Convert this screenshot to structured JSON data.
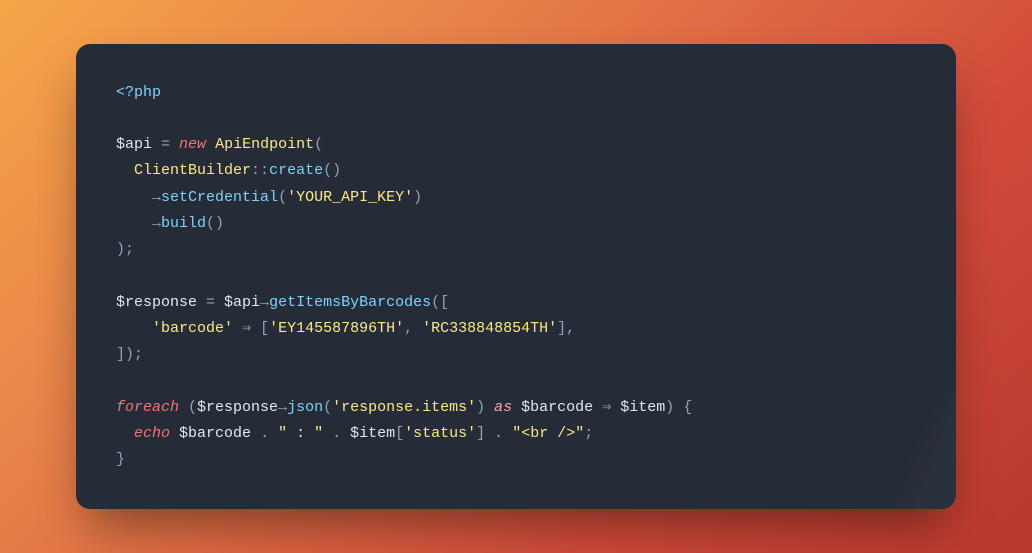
{
  "code": {
    "l1_open": "<?php",
    "l3_var": "$api",
    "l3_eq": " = ",
    "l3_new": "new",
    "l3_sp": " ",
    "l3_cls": "ApiEndpoint",
    "l3_op": "(",
    "l4_ind": "  ",
    "l4_cls": "ClientBuilder",
    "l4_sc": "::",
    "l4_fn": "create",
    "l4_par": "()",
    "l5_ind": "    ",
    "l5_arrow": "→",
    "l5_fn": "setCredential",
    "l5_op": "(",
    "l5_str": "'YOUR_API_KEY'",
    "l5_cp": ")",
    "l6_ind": "    ",
    "l6_arrow": "→",
    "l6_fn": "build",
    "l6_par": "()",
    "l7_close": ");",
    "l9_var": "$response",
    "l9_eq": " = ",
    "l9_api": "$api",
    "l9_arrow": "→",
    "l9_fn": "getItemsByBarcodes",
    "l9_op": "([",
    "l10_ind": "    ",
    "l10_key": "'barcode'",
    "l10_fat": " ⇒ ",
    "l10_ob": "[",
    "l10_s1": "'EY145587896TH'",
    "l10_cm": ", ",
    "l10_s2": "'RC338848854TH'",
    "l10_cb": "],",
    "l11_close": "]);",
    "l13_kw": "foreach",
    "l13_sp": " (",
    "l13_resp": "$response",
    "l13_arrow": "→",
    "l13_fn": "json",
    "l13_op": "(",
    "l13_str": "'response.items'",
    "l13_cp": ") ",
    "l13_as": "as",
    "l13_sp2": " ",
    "l13_bar": "$barcode",
    "l13_fat": " ⇒ ",
    "l13_item": "$item",
    "l13_brace": ") {",
    "l14_ind": "  ",
    "l14_echo": "echo",
    "l14_sp": " ",
    "l14_bar": "$barcode",
    "l14_cat1": " . ",
    "l14_s1": "\" : \"",
    "l14_cat2": " . ",
    "l14_item": "$item",
    "l14_ob": "[",
    "l14_key": "'status'",
    "l14_cb": "]",
    "l14_cat3": " . ",
    "l14_s2": "\"<br />\"",
    "l14_semi": ";",
    "l15_close": "}"
  }
}
